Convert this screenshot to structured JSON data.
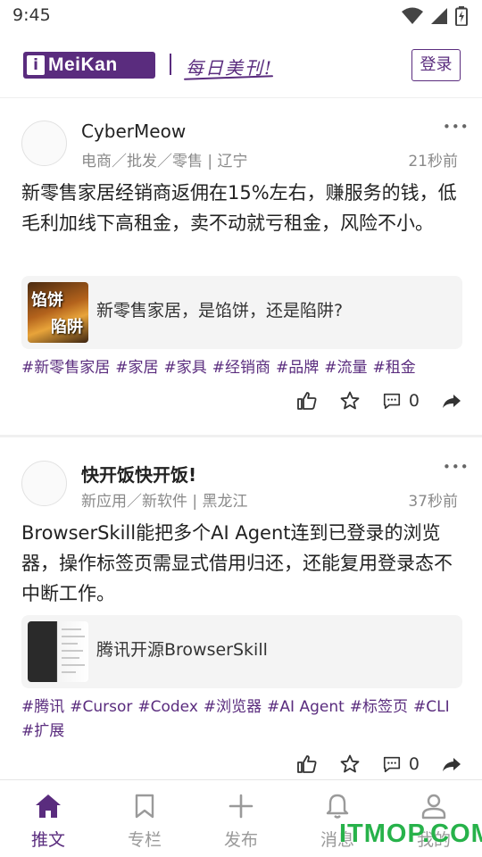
{
  "status_bar": {
    "time": "9:45",
    "icons": [
      "wifi-icon",
      "signal-icon",
      "battery-charging-icon"
    ]
  },
  "header": {
    "logo_text": "MeiKan",
    "logo_letter": "i",
    "slogan": "每日美刊!",
    "login_label": "登录",
    "brand_color": "#5a2c7e"
  },
  "posts": [
    {
      "author": "CyberMeow",
      "meta": "电商／批发／零售 | 辽宁",
      "time": "21秒前",
      "content": "新零售家居经销商返佣在15%左右，赚服务的钱，低毛利加线下高租金，卖不动就亏租金，风险不小。",
      "card_title": "新零售家居，是馅饼，还是陷阱?",
      "thumb_text": [
        "馅饼",
        "陷阱"
      ],
      "tags": [
        "#新零售家居",
        "#家居",
        "#家具",
        "#经销商",
        "#品牌",
        "#流量",
        "#租金"
      ],
      "comments": "0"
    },
    {
      "author": "快开饭快开饭!",
      "meta": "新应用／新软件 | 黑龙江",
      "time": "37秒前",
      "content": "BrowserSkill能把多个AI Agent连到已登录的浏览器，操作标签页需显式借用归还，还能复用登录态不中断工作。",
      "card_title": "腾讯开源BrowserSkill",
      "tags": [
        "#腾讯",
        "#Cursor",
        "#Codex",
        "#浏览器",
        "#AI Agent",
        "#标签页",
        "#CLI",
        "#扩展"
      ],
      "comments": "0"
    }
  ],
  "nav": {
    "items": [
      {
        "label": "推文",
        "icon": "home-icon",
        "active": true
      },
      {
        "label": "专栏",
        "icon": "bookmark-icon",
        "active": false
      },
      {
        "label": "发布",
        "icon": "plus-icon",
        "active": false
      },
      {
        "label": "消息",
        "icon": "bell-icon",
        "active": false
      },
      {
        "label": "我的",
        "icon": "user-icon",
        "active": false
      }
    ]
  },
  "watermark": "ITMOP.COM"
}
